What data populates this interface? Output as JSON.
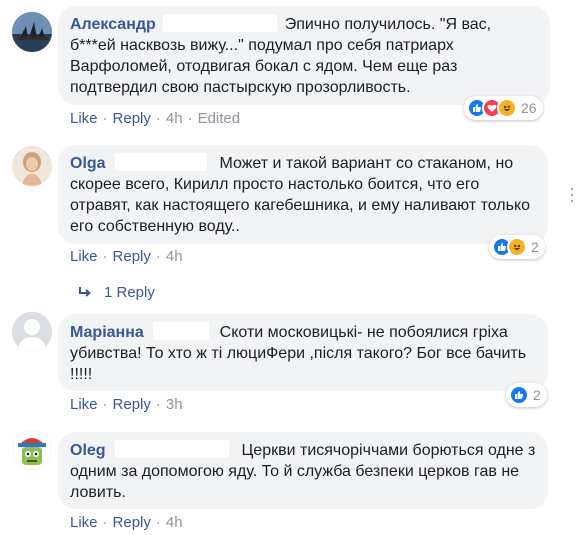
{
  "colors": {
    "link": "#385898",
    "meta": "#90949c",
    "bubble": "#f2f3f5",
    "like_blue": "#1877f2",
    "love_red": "#f33e58",
    "haha_yellow": "#f7b125"
  },
  "comments": [
    {
      "author": "Александр",
      "text": "Эпично получилось. \"Я вас, б***ей насквозь вижу...\" подумал про себя патриарх Варфоломей, отодвигая бокал с ядом. Чем еще раз подтвердил свою пастырскую прозорливость.",
      "reactions": [
        "like-icon",
        "love-icon",
        "haha-icon"
      ],
      "reaction_count": "26",
      "like_label": "Like",
      "reply_label": "Reply",
      "time": "4h",
      "edited": "Edited"
    },
    {
      "author": "Olga",
      "text": "Может и такой вариант со стаканом, но скорее всего, Кирилл просто настолько боится, что его отравят, как настоящего кагебешника, и ему наливают только его собственную воду..",
      "reactions": [
        "like-icon",
        "haha-icon"
      ],
      "reaction_count": "2",
      "like_label": "Like",
      "reply_label": "Reply",
      "time": "4h",
      "replies_label": "1 Reply"
    },
    {
      "author": "Маріанна",
      "text": "Скоти московицькі- не побоялися гріха убивства! То хто ж ті люциФери ,після такого? Бог все бачить !!!!!",
      "reactions": [
        "like-icon"
      ],
      "reaction_count": "2",
      "like_label": "Like",
      "reply_label": "Reply",
      "time": "3h"
    },
    {
      "author": "Oleg",
      "text": "Церкви тисячоріччами борються одне з одним за допомогою яду. То й служба безпеки церков гав не ловить.",
      "like_label": "Like",
      "reply_label": "Reply",
      "time": "4h"
    }
  ]
}
